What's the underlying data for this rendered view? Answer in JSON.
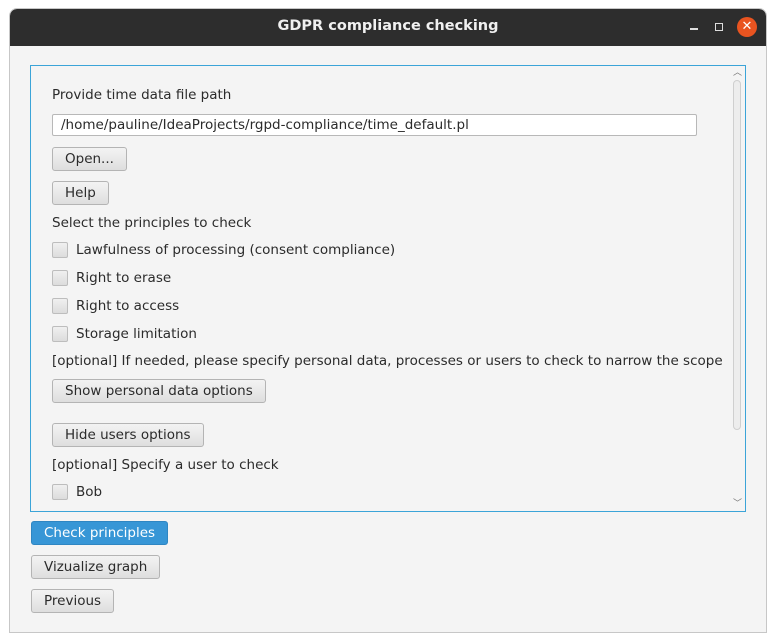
{
  "window": {
    "title": "GDPR compliance checking"
  },
  "titlebar_icons": {
    "minimize": "minimize-icon",
    "maximize": "maximize-icon",
    "close": "close-icon",
    "close_glyph": "✕"
  },
  "form": {
    "file_label": "Provide time data file path",
    "file_path": "/home/pauline/IdeaProjects/rgpd-compliance/time_default.pl",
    "open_button": "Open...",
    "help_button": "Help",
    "principles_label": "Select the principles to check",
    "principles": [
      {
        "label": "Lawfulness of processing (consent compliance)",
        "checked": false
      },
      {
        "label": "Right to erase",
        "checked": false
      },
      {
        "label": "Right to access",
        "checked": false
      },
      {
        "label": "Storage limitation",
        "checked": false
      }
    ],
    "optional_scope_label": "[optional] If needed, please specify personal data, processes or users to check to narrow the scope",
    "personal_data_button": "Show personal data options",
    "users_button": "Hide users options",
    "user_label": "[optional] Specify a user to check",
    "users": [
      {
        "label": "Bob",
        "checked": false
      }
    ]
  },
  "scrollbar": {
    "up_glyph": "︿",
    "down_glyph": "﹀"
  },
  "actions": {
    "check_principles": "Check principles",
    "visualize_graph": "Vizualize graph",
    "previous": "Previous"
  },
  "colors": {
    "accent": "#3796d6",
    "focus_border": "#3ba4d8",
    "titlebar": "#2d2d2d",
    "close": "#e95420"
  }
}
